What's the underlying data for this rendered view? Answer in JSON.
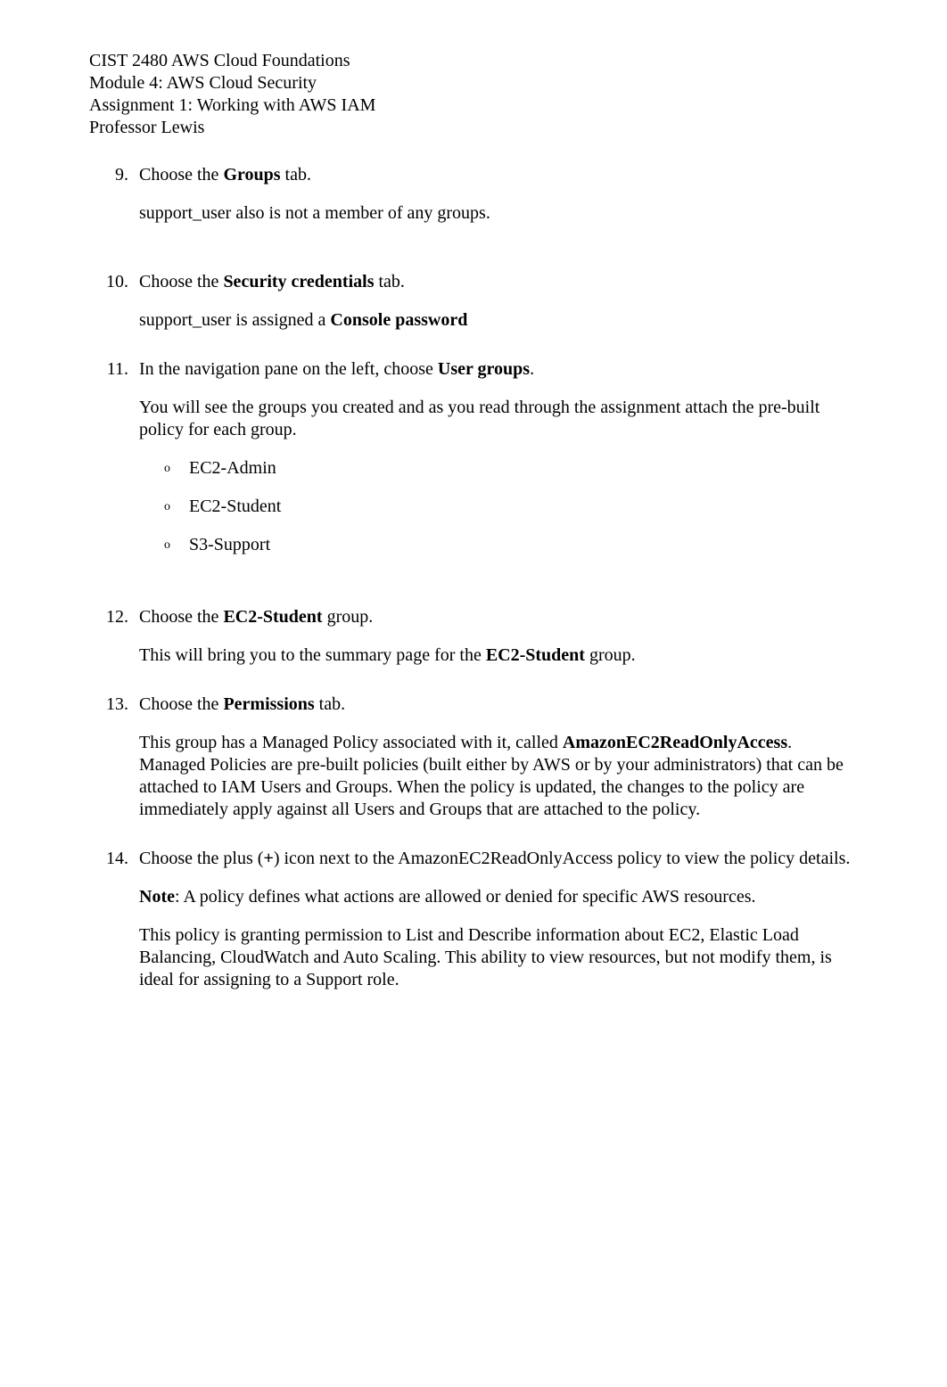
{
  "header": {
    "line1": "CIST 2480 AWS Cloud Foundations",
    "line2": "Module 4: AWS Cloud Security",
    "line3": "Assignment 1: Working with AWS IAM",
    "line4": "Professor Lewis"
  },
  "items": {
    "n9": {
      "num": "9.",
      "p1a": "Choose the ",
      "p1b": "Groups",
      "p1c": " tab.",
      "p2": "support_user also is not a member of any groups."
    },
    "n10": {
      "num": "10.",
      "p1a": "Choose the ",
      "p1b": "Security credentials",
      "p1c": " tab.",
      "p2a": "support_user is assigned a ",
      "p2b": "Console password"
    },
    "n11": {
      "num": "11.",
      "p1a": "In the navigation pane on the left, choose ",
      "p1b": "User groups",
      "p1c": ".",
      "p2": "You will see the groups you created and as you read through the assignment attach the pre-built policy for each group.",
      "sub": {
        "marker": "o",
        "a": "EC2-Admin",
        "b": "EC2-Student",
        "c": "S3-Support"
      }
    },
    "n12": {
      "num": "12.",
      "p1a": "Choose the ",
      "p1b": "EC2-Student",
      "p1c": " group.",
      "p2a": "This will bring you to the summary page for the ",
      "p2b": "EC2-Student",
      "p2c": " group."
    },
    "n13": {
      "num": "13.",
      "p1a": "Choose the ",
      "p1b": "Permissions",
      "p1c": " tab.",
      "p2a": "This group has a Managed Policy associated with it, called ",
      "p2b": "AmazonEC2ReadOnlyAccess",
      "p2c": ". Managed Policies are pre-built policies (built either by AWS or by your administrators) that can be attached to IAM Users and Groups. When the policy is updated, the changes to the policy are immediately apply against all Users and Groups that are attached to the policy."
    },
    "n14": {
      "num": "14.",
      "p1a": "Choose the plus (",
      "p1b": "+",
      "p1c": ") icon next to the AmazonEC2ReadOnlyAccess policy to view the policy details.",
      "p2a": "Note",
      "p2b": ": A policy defines what actions are allowed or denied for specific AWS resources.",
      "p3": "This policy is granting permission to List and Describe information about EC2, Elastic Load Balancing, CloudWatch and Auto Scaling. This ability to view resources, but not modify them, is ideal for assigning to a Support role."
    }
  }
}
